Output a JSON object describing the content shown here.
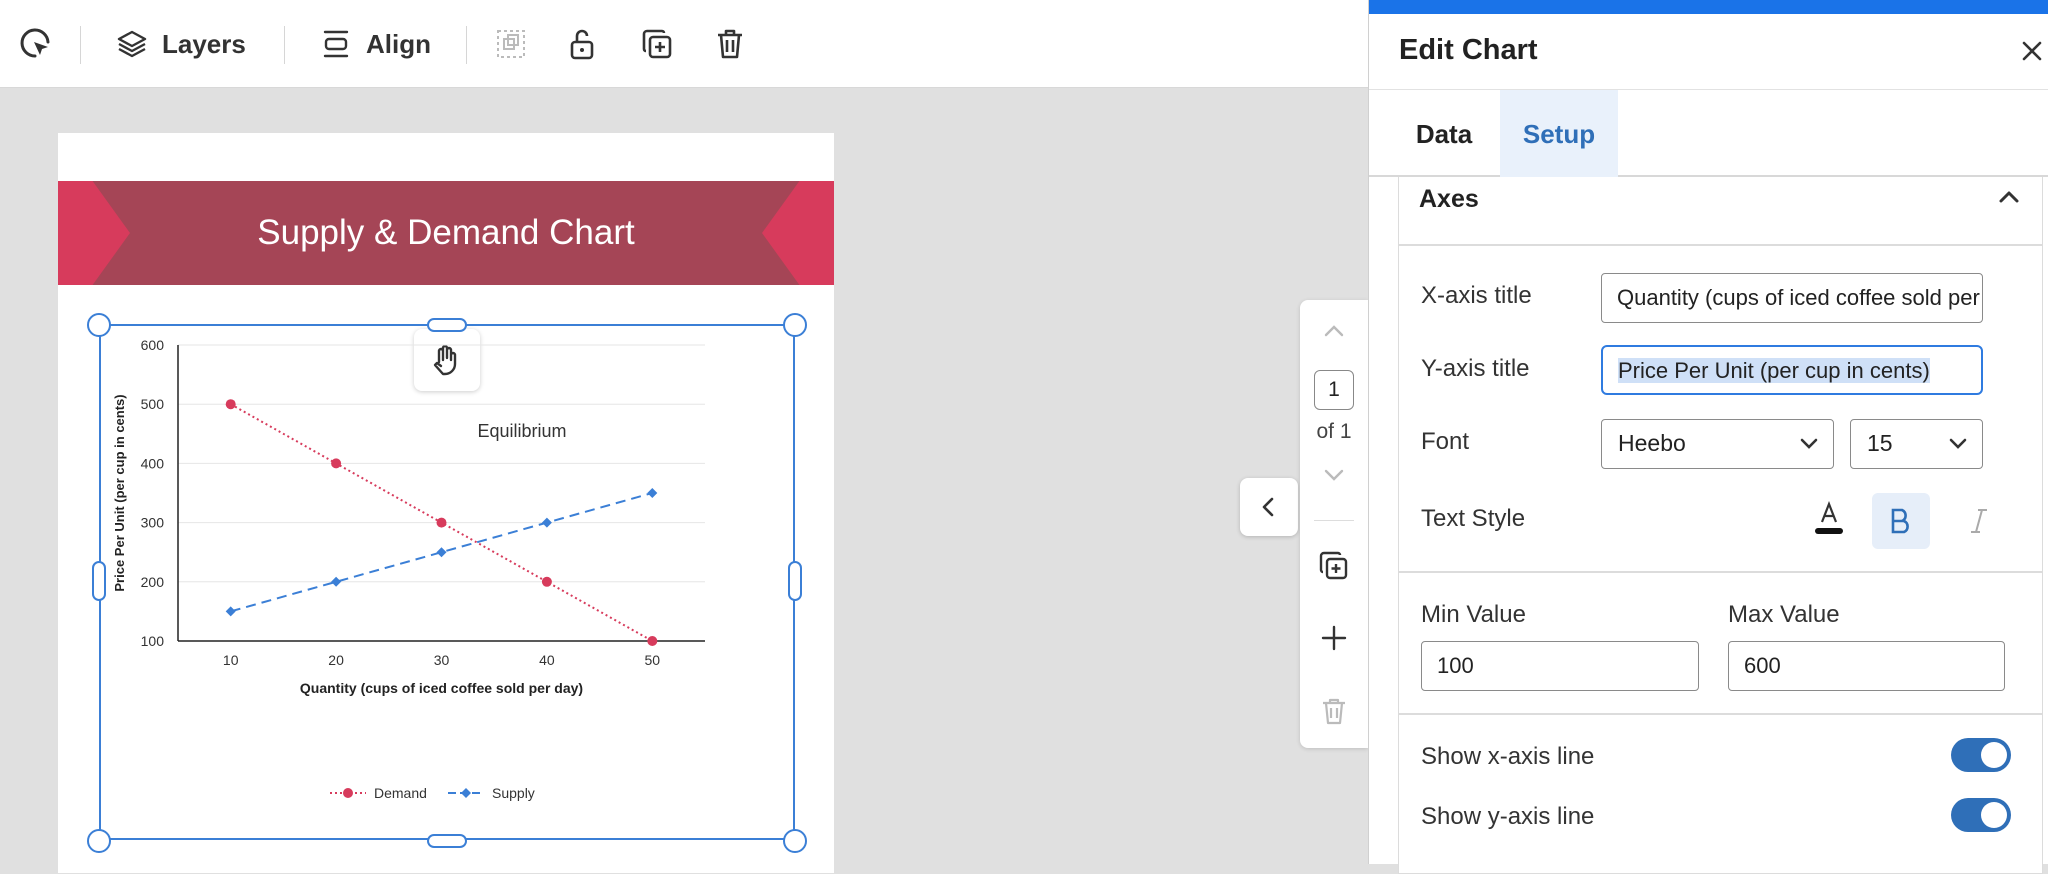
{
  "toolbar": {
    "layers_label": "Layers",
    "align_label": "Align"
  },
  "document": {
    "banner_title": "Supply & Demand Chart"
  },
  "pager": {
    "current_page": "1",
    "of_label": "of 1"
  },
  "panel": {
    "title": "Edit Chart",
    "tabs": [
      {
        "label": "Data",
        "active": false
      },
      {
        "label": "Setup",
        "active": true
      }
    ],
    "axes_section": {
      "heading": "Axes",
      "x_axis_title_label": "X-axis title",
      "x_axis_title_value": "Quantity (cups of iced coffee sold per day)",
      "y_axis_title_label": "Y-axis title",
      "y_axis_title_value": "Price Per Unit (per cup in cents)",
      "font_label": "Font",
      "font_value": "Heebo",
      "font_size_value": "15",
      "text_style_label": "Text Style",
      "min_value_label": "Min Value",
      "min_value": "100",
      "max_value_label": "Max Value",
      "max_value": "600",
      "show_x_axis_line_label": "Show x-axis line",
      "show_x_axis_line": true,
      "show_y_axis_line_label": "Show y-axis line",
      "show_y_axis_line": true
    }
  },
  "colors": {
    "banner": "#a54556",
    "banner_ribbon": "#d73b5c",
    "demand": "#d73b5c",
    "supply": "#3b7fd6",
    "accent": "#1a73e8",
    "selection": "#3b7fd6"
  },
  "chart_data": {
    "type": "line",
    "x": [
      10,
      20,
      30,
      40,
      50
    ],
    "series": [
      {
        "name": "Demand",
        "values": [
          500,
          400,
          300,
          200,
          100
        ],
        "color": "#d73b5c",
        "style": "dotted",
        "marker": "circle"
      },
      {
        "name": "Supply",
        "values": [
          150,
          200,
          250,
          300,
          350
        ],
        "color": "#3b7fd6",
        "style": "dashed",
        "marker": "diamond"
      }
    ],
    "xlabel": "Quantity (cups of iced coffee sold per day)",
    "ylabel": "Price Per Unit (per cup in cents)",
    "ylim": [
      100,
      600
    ],
    "xlim": [
      5,
      55
    ],
    "yticks": [
      100,
      200,
      300,
      400,
      500,
      600
    ],
    "xticks": [
      10,
      20,
      30,
      40,
      50
    ],
    "annotation": "Equilibrium",
    "legend_position": "bottom",
    "grid": true
  }
}
